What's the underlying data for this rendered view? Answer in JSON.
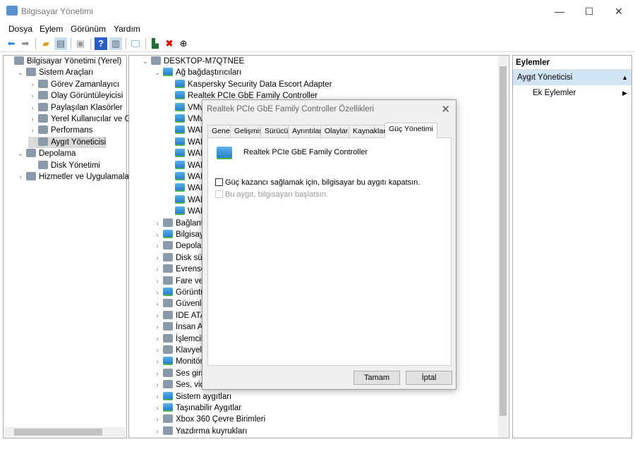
{
  "window": {
    "title": "Bilgisayar Yönetimi",
    "minimize": "—",
    "maximize": "☐",
    "close": "✕"
  },
  "menu": [
    "Dosya",
    "Eylem",
    "Görünüm",
    "Yardım"
  ],
  "left_tree": [
    {
      "label": "Bilgisayar Yönetimi (Yerel)",
      "level": 0,
      "chevron": ""
    },
    {
      "label": "Sistem Araçları",
      "level": 1,
      "chevron": "⌄"
    },
    {
      "label": "Görev Zamanlayıcı",
      "level": 2,
      "chevron": "›"
    },
    {
      "label": "Olay Görüntüleyicisi",
      "level": 2,
      "chevron": "›"
    },
    {
      "label": "Paylaşılan Klasörler",
      "level": 2,
      "chevron": "›"
    },
    {
      "label": "Yerel Kullanıcılar ve Gru",
      "level": 2,
      "chevron": "›"
    },
    {
      "label": "Performans",
      "level": 2,
      "chevron": "›"
    },
    {
      "label": "Aygıt Yöneticisi",
      "level": 2,
      "chevron": "",
      "selected": true
    },
    {
      "label": "Depolama",
      "level": 1,
      "chevron": "⌄"
    },
    {
      "label": "Disk Yönetimi",
      "level": 2,
      "chevron": ""
    },
    {
      "label": "Hizmetler ve Uygulamalar",
      "level": 1,
      "chevron": "›"
    }
  ],
  "device_tree": [
    {
      "label": "DESKTOP-M7QTNEE",
      "level": 0,
      "chevron": "⌄",
      "icon": "gen"
    },
    {
      "label": "Ağ bağdaştırıcıları",
      "level": 1,
      "chevron": "⌄",
      "icon": "net"
    },
    {
      "label": "Kaspersky Security Data Escort Adapter",
      "level": 2,
      "chevron": "",
      "icon": "net"
    },
    {
      "label": "Realtek PCIe GbE Family Controller",
      "level": 2,
      "chevron": "",
      "icon": "net"
    },
    {
      "label": "VMwa",
      "level": 2,
      "chevron": "",
      "icon": "net"
    },
    {
      "label": "VMwa",
      "level": 2,
      "chevron": "",
      "icon": "net"
    },
    {
      "label": "WAN I",
      "level": 2,
      "chevron": "",
      "icon": "net"
    },
    {
      "label": "WAN I",
      "level": 2,
      "chevron": "",
      "icon": "net"
    },
    {
      "label": "WAN I",
      "level": 2,
      "chevron": "",
      "icon": "net"
    },
    {
      "label": "WAN I",
      "level": 2,
      "chevron": "",
      "icon": "net"
    },
    {
      "label": "WAN I",
      "level": 2,
      "chevron": "",
      "icon": "net"
    },
    {
      "label": "WAN I",
      "level": 2,
      "chevron": "",
      "icon": "net"
    },
    {
      "label": "WAN I",
      "level": 2,
      "chevron": "",
      "icon": "net"
    },
    {
      "label": "WAN I",
      "level": 2,
      "chevron": "",
      "icon": "net"
    },
    {
      "label": "Bağlantı n",
      "level": 1,
      "chevron": "›",
      "icon": "gen"
    },
    {
      "label": "Bilgisayar",
      "level": 1,
      "chevron": "›",
      "icon": "net"
    },
    {
      "label": "Depolama",
      "level": 1,
      "chevron": "›",
      "icon": "gen"
    },
    {
      "label": "Disk sürüc",
      "level": 1,
      "chevron": "›",
      "icon": "gen"
    },
    {
      "label": "Evrensel S",
      "level": 1,
      "chevron": "›",
      "icon": "gen"
    },
    {
      "label": "Fare ve diğ",
      "level": 1,
      "chevron": "›",
      "icon": "gen"
    },
    {
      "label": "Görüntü b",
      "level": 1,
      "chevron": "›",
      "icon": "net"
    },
    {
      "label": "Güvenlik c",
      "level": 1,
      "chevron": "›",
      "icon": "gen"
    },
    {
      "label": "IDE ATA/A",
      "level": 1,
      "chevron": "›",
      "icon": "gen"
    },
    {
      "label": "İnsan Arab",
      "level": 1,
      "chevron": "›",
      "icon": "gen"
    },
    {
      "label": "İşlemciler",
      "level": 1,
      "chevron": "›",
      "icon": "gen"
    },
    {
      "label": "Klavyeler",
      "level": 1,
      "chevron": "›",
      "icon": "gen"
    },
    {
      "label": "Monitörle",
      "level": 1,
      "chevron": "›",
      "icon": "net"
    },
    {
      "label": "Ses girişle",
      "level": 1,
      "chevron": "›",
      "icon": "gen"
    },
    {
      "label": "Ses, video",
      "level": 1,
      "chevron": "›",
      "icon": "gen"
    },
    {
      "label": "Sistem aygıtları",
      "level": 1,
      "chevron": "›",
      "icon": "net"
    },
    {
      "label": "Taşınabilir Aygıtlar",
      "level": 1,
      "chevron": "›",
      "icon": "net"
    },
    {
      "label": "Xbox 360 Çevre Birimleri",
      "level": 1,
      "chevron": "›",
      "icon": "gen"
    },
    {
      "label": "Yazdırma kuyrukları",
      "level": 1,
      "chevron": "›",
      "icon": "gen"
    }
  ],
  "actions": {
    "header": "Eylemler",
    "section": "Aygıt Yöneticisi",
    "more": "Ek Eylemler"
  },
  "dialog": {
    "title": "Realtek PCIe GbE Family Controller Özellikleri",
    "close": "✕",
    "tabs": [
      "Genel",
      "Gelişmiş",
      "Sürücü",
      "Ayrıntılar",
      "Olaylar",
      "Kaynaklar",
      "Güç Yönetimi"
    ],
    "active_tab": 6,
    "device_name": "Realtek PCIe GbE Family Controller",
    "option1": "Güç kazancı sağlamak için, bilgisayar bu aygıtı kapatsın.",
    "option1_checked": false,
    "option2": "Bu aygıt, bilgisayarı başlatsın.",
    "option2_enabled": false,
    "ok": "Tamam",
    "cancel": "İptal"
  }
}
